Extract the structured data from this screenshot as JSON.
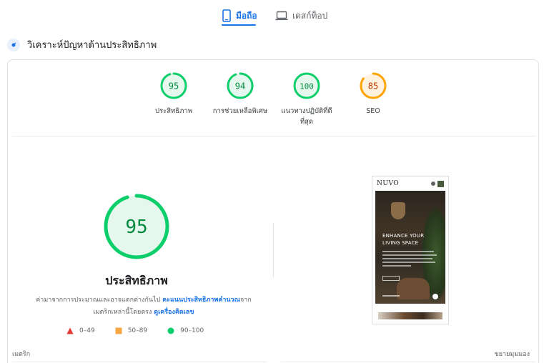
{
  "tabs": [
    {
      "label": "มือถือ",
      "active": true,
      "icon": "smartphone-icon"
    },
    {
      "label": "เดสก์ท็อป",
      "active": false,
      "icon": "laptop-icon"
    }
  ],
  "diagnose": {
    "title": "วิเคราะห์ปัญหาด้านประสิทธิภาพ",
    "icon": "performance-icon"
  },
  "scores": [
    {
      "value": "95",
      "fraction": 0.95,
      "label": "ประสิทธิภาพ",
      "status": "pass"
    },
    {
      "value": "94",
      "fraction": 0.94,
      "label": "การช่วยเหลือพิเศษ",
      "status": "pass"
    },
    {
      "value": "100",
      "fraction": 1.0,
      "label_line1": "แนวทางปฏิบัติที่ดี",
      "label_line2": "ที่สุด",
      "status": "pass"
    },
    {
      "value": "85",
      "fraction": 0.85,
      "label": "SEO",
      "status": "average"
    }
  ],
  "performance": {
    "score": "95",
    "fraction": 0.95,
    "title": "ประสิทธิภาพ",
    "desc_part1": "ค่ามาจากการประมาณและอาจแตกต่างกันไป ",
    "desc_link1": "คะแนนประสิทธิภาพคำนวณ",
    "desc_part2": "จาก",
    "desc_part3": "เมตริกเหล่านี้โดยตรง ",
    "desc_link2": "ดูเครื่องคิดเลข"
  },
  "legend": [
    {
      "label": "0–49",
      "shape": "triangle",
      "color": "#e53935"
    },
    {
      "label": "50–89",
      "shape": "square",
      "color": "#f4a742"
    },
    {
      "label": "90–100",
      "shape": "circle",
      "color": "#0cce6b"
    }
  ],
  "footer": {
    "metrics_label": "เมตริก",
    "expand_label": "ขยายมุมมอง"
  },
  "preview": {
    "logo": "NUVO",
    "hero_line1": "ENHANCE YOUR",
    "hero_line2": "LIVING SPACE"
  },
  "colors": {
    "accent": "#1a73e8",
    "pass": "#0cce6b",
    "pass_text": "#008a3e",
    "average": "#ffa400",
    "average_text": "#c33300",
    "fail": "#e53935"
  }
}
